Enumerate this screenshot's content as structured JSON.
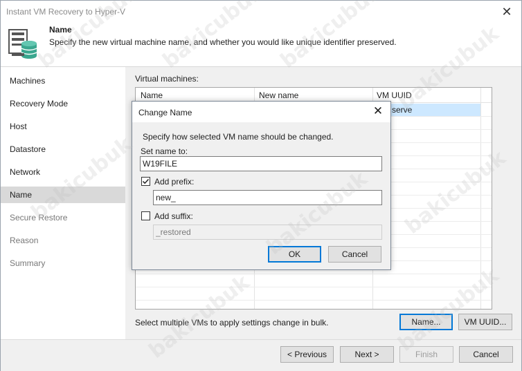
{
  "window": {
    "title": "Instant VM Recovery to Hyper-V",
    "close_glyph": "✕"
  },
  "header": {
    "title": "Name",
    "description": "Specify the new virtual machine name, and whether you would like unique identifier preserved."
  },
  "sidebar": {
    "items": [
      {
        "label": "Machines",
        "state": "normal"
      },
      {
        "label": "Recovery Mode",
        "state": "normal"
      },
      {
        "label": "Host",
        "state": "normal"
      },
      {
        "label": "Datastore",
        "state": "normal"
      },
      {
        "label": "Network",
        "state": "normal"
      },
      {
        "label": "Name",
        "state": "active"
      },
      {
        "label": "Secure Restore",
        "state": "disabled"
      },
      {
        "label": "Reason",
        "state": "disabled"
      },
      {
        "label": "Summary",
        "state": "disabled"
      }
    ]
  },
  "content": {
    "vm_label": "Virtual machines:",
    "columns": [
      "Name",
      "New name",
      "VM UUID"
    ],
    "selected_row_uuid": "serve",
    "bulk_note": "Select multiple VMs to apply settings change in bulk.",
    "name_button": "Name...",
    "uuid_button": "VM UUID..."
  },
  "footer": {
    "previous": "< Previous",
    "next": "Next >",
    "finish": "Finish",
    "cancel": "Cancel"
  },
  "dialog": {
    "title": "Change Name",
    "close_glyph": "✕",
    "instruction": "Specify how selected VM name should be changed.",
    "set_name_label": "Set name to:",
    "set_name_value": "W19FILE",
    "prefix_label": "Add prefix:",
    "prefix_checked": true,
    "prefix_value": "new_",
    "suffix_label": "Add suffix:",
    "suffix_checked": false,
    "suffix_value": "_restored",
    "ok": "OK",
    "cancel": "Cancel"
  },
  "watermark": "bakicubuk",
  "colors": {
    "selection": "#cde8ff",
    "focus_border": "#0078d7",
    "accent_icon": "#2e9e8f"
  }
}
